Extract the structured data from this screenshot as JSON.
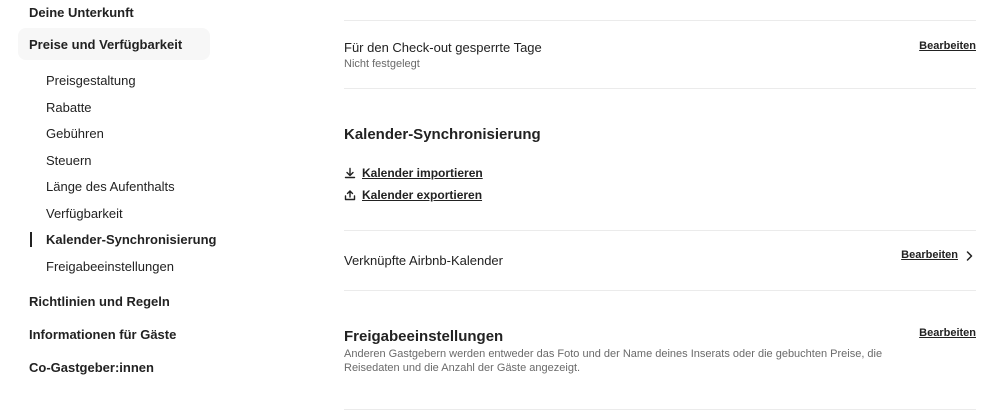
{
  "sidebar": {
    "sections": [
      {
        "label": "Deine Unterkunft"
      },
      {
        "label": "Preise und Verfügbarkeit"
      },
      {
        "label": "Richtlinien und Regeln"
      },
      {
        "label": "Informationen für Gäste"
      },
      {
        "label": "Co-Gastgeber:innen"
      }
    ],
    "subitems": [
      {
        "label": "Preisgestaltung"
      },
      {
        "label": "Rabatte"
      },
      {
        "label": "Gebühren"
      },
      {
        "label": "Steuern"
      },
      {
        "label": "Länge des Aufenthalts"
      },
      {
        "label": "Verfügbarkeit"
      },
      {
        "label": "Kalender-Synchronisierung"
      },
      {
        "label": "Freigabeeinstellungen"
      }
    ]
  },
  "main": {
    "checkout_blocked": {
      "title": "Für den Check-out gesperrte Tage",
      "value": "Nicht festgelegt",
      "edit_label": "Bearbeiten"
    },
    "calendar_sync": {
      "heading": "Kalender-Synchronisierung",
      "import_label": "Kalender importieren",
      "export_label": "Kalender exportieren"
    },
    "linked_calendars": {
      "title": "Verknüpfte Airbnb-Kalender",
      "edit_label": "Bearbeiten"
    },
    "sharing": {
      "heading": "Freigabeeinstellungen",
      "description": "Anderen Gastgebern werden entweder das Foto und der Name deines Inserats oder die gebuchten Preise, die Reisedaten und die Anzahl der Gäste angezeigt.",
      "edit_label": "Bearbeiten"
    }
  },
  "icons": {
    "import": "download-icon",
    "export": "upload-icon",
    "chevron": "chevron-right-icon"
  },
  "colors": {
    "text": "#222222",
    "muted": "#6a6a6a",
    "divider": "#ebebeb",
    "active_bg": "#f7f7f7"
  }
}
